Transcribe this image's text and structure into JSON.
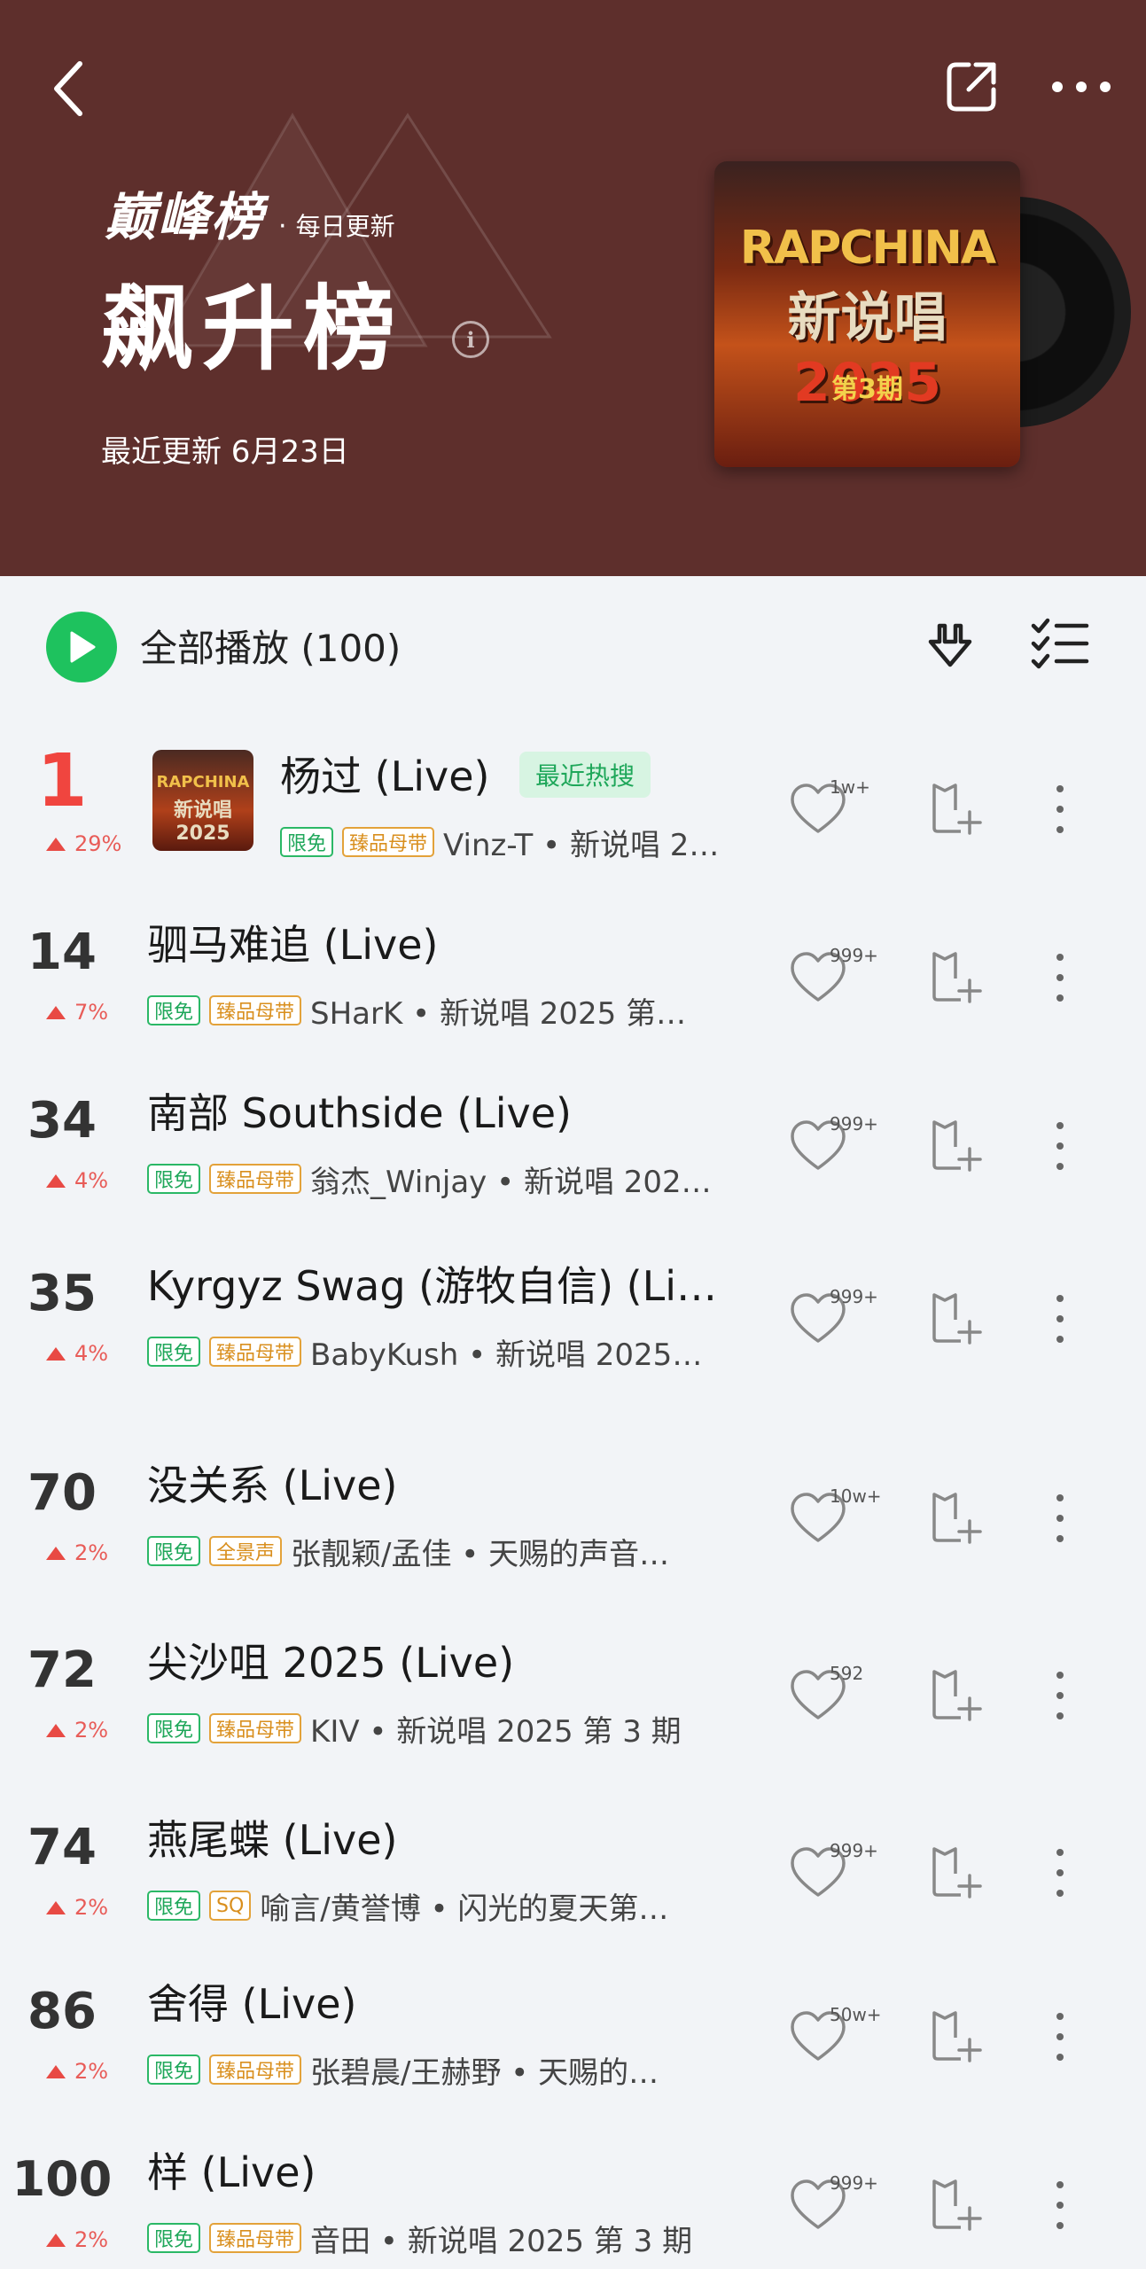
{
  "header": {
    "brand_name": "巅峰榜",
    "brand_dot": "·",
    "brand_sub": "每日更新",
    "title": "飙升榜",
    "info_glyph": "i",
    "updated": "最近更新 6月23日",
    "cover": {
      "line1": "RAPCHINA",
      "line2_a": "新说唱",
      "line2_b": "2025",
      "line3": "第3期"
    },
    "bg_color": "#5e2f2c"
  },
  "toolbar": {
    "play_all_label": "全部播放 (100)",
    "accent_color": "#1ec25e"
  },
  "songs": [
    {
      "rank": "1",
      "trend": "29%",
      "title": "杨过 (Live)",
      "hot_tag": "最近热搜",
      "badges": [
        "限免",
        "臻品母带"
      ],
      "meta": "Vinz-T  •  新说唱 2…",
      "likes": "1w+",
      "thumb_line1": "RAPCHINA",
      "thumb_line2": "新说唱2025"
    },
    {
      "rank": "14",
      "trend": "7%",
      "title": "驷马难追 (Live)",
      "badges": [
        "限免",
        "臻品母带"
      ],
      "meta": "SHarK  •  新说唱 2025 第…",
      "likes": "999+"
    },
    {
      "rank": "34",
      "trend": "4%",
      "title": "南部 Southside (Live)",
      "badges": [
        "限免",
        "臻品母带"
      ],
      "meta": "翁杰_Winjay  •  新说唱 202…",
      "likes": "999+"
    },
    {
      "rank": "35",
      "trend": "4%",
      "title": "Kyrgyz Swag (游牧自信) (Li…",
      "badges": [
        "限免",
        "臻品母带"
      ],
      "meta": "BabyKush  •  新说唱 2025…",
      "likes": "999+"
    },
    {
      "rank": "70",
      "trend": "2%",
      "title": "没关系 (Live)",
      "badges": [
        "限免",
        "全景声"
      ],
      "meta": "张靓颖/孟佳  •  天赐的声音…",
      "likes": "10w+"
    },
    {
      "rank": "72",
      "trend": "2%",
      "title": "尖沙咀 2025 (Live)",
      "badges": [
        "限免",
        "臻品母带"
      ],
      "meta": "KIV  •  新说唱 2025 第 3 期",
      "likes": "592"
    },
    {
      "rank": "74",
      "trend": "2%",
      "title": "燕尾蝶 (Live)",
      "badges": [
        "限免",
        "SQ"
      ],
      "meta": "喻言/黄誉博  •  闪光的夏天第…",
      "likes": "999+"
    },
    {
      "rank": "86",
      "trend": "2%",
      "title": "舍得 (Live)",
      "badges": [
        "限免",
        "臻品母带"
      ],
      "meta": "张碧晨/王赫野  •  天赐的…",
      "likes": "50w+"
    },
    {
      "rank": "100",
      "trend": "2%",
      "title": "样 (Live)",
      "badges": [
        "限免",
        "臻品母带"
      ],
      "meta": "音田  •  新说唱 2025 第 3 期",
      "likes": "999+"
    }
  ]
}
